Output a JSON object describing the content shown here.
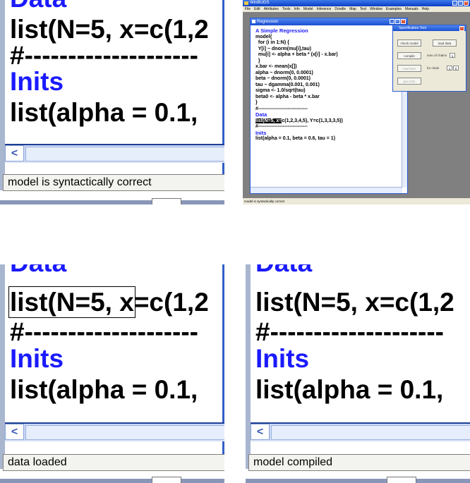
{
  "zoom_panels": [
    {
      "heading": "Data",
      "data_line": "list(N=5, x=c(1,2",
      "separator": "#--------------------",
      "inits_heading": "Inits",
      "inits_line": "list(alpha = 0.1,",
      "scroll_left": "<",
      "status": "model is syntactically correct"
    },
    {
      "heading": "Data",
      "data_line_selected": "list(N=5, x",
      "data_line_rest": "=c(1,2",
      "separator": "#--------------------",
      "inits_heading": "Inits",
      "inits_line": "list(alpha = 0.1,",
      "scroll_left": "<",
      "status": "data loaded"
    },
    {
      "heading": "Data",
      "data_line": "list(N=5, x=c(1,2",
      "separator": "#--------------------",
      "inits_heading": "Inits",
      "inits_line": "list(alpha = 0.1,",
      "scroll_left": "<",
      "status": "model compiled"
    }
  ],
  "mini_window": {
    "app_title": "WinBUGS",
    "menu": [
      "File",
      "Edit",
      "Attributes",
      "Tools",
      "Info",
      "Model",
      "Inference",
      "Doodle",
      "Map",
      "Text",
      "Window",
      "Examples",
      "Manuals",
      "Help"
    ],
    "doc_title": "Regression",
    "code": {
      "title": "A Simple Regression",
      "lines": [
        "model{",
        "  for (i in 1:N) {",
        "  Y[i] ~ dnorm(mu[i],tau)",
        "  mu[i] <- alpha + beta * (x[i] - x.bar)",
        "  }",
        "x.bar <- mean(x[])",
        "alpha ~ dnorm(0, 0.0001)",
        "beta ~ dnorm(0, 0.0001)",
        "tau ~ dgamma(0.001, 0.001)",
        "sigma <- 1.0/sqrt(tau)",
        "beta0 <- alpha - beta * x.bar",
        "}",
        "#------------------------------"
      ],
      "data_heading": "Data",
      "data_selected": "list(N=5, x=",
      "data_rest": "c(1,2,3,4,5), Y=c(1,3,3,3,5))",
      "separator2": "#------------------------------",
      "inits_heading": "Inits",
      "inits_line": "list(alpha = 0.1, beta = 0.6, tau = 1)"
    },
    "spec_tool": {
      "title": "Specification Tool",
      "check_model": "check model",
      "load_data": "load data",
      "compile": "compile",
      "num_chains_label": "num of chains",
      "num_chains_value": "1",
      "load_inits": "load inits",
      "gen_inits": "gen inits",
      "for_chain_label": "for chain",
      "for_chain_value": "1"
    },
    "status": "model is syntactically correct"
  }
}
